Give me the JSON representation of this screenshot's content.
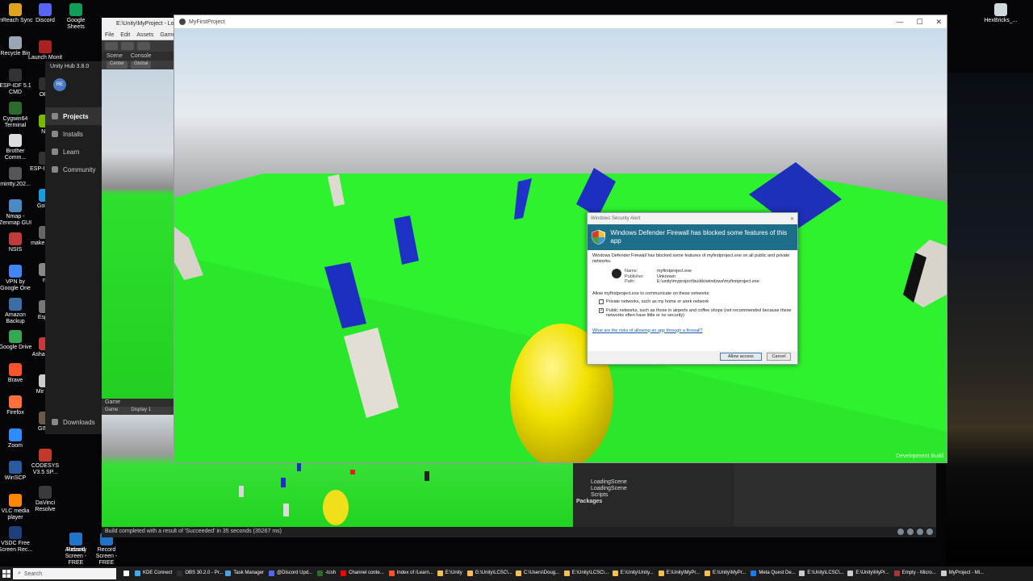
{
  "desktop": {
    "left_icons": [
      {
        "label": "inReach Sync",
        "color": "#e0a21c"
      },
      {
        "label": "Recycle Bin",
        "color": "#9aa5b5"
      },
      {
        "label": "ESP-IDF 5.1 CMD",
        "color": "#333333"
      },
      {
        "label": "Cygwin64 Terminal",
        "color": "#2b6b2b"
      },
      {
        "label": "Brother Comm...",
        "color": "#dddddd"
      },
      {
        "label": "mintty.202...",
        "color": "#555555"
      },
      {
        "label": "Nmap - Zenmap GUI",
        "color": "#4a8ac4"
      },
      {
        "label": "NSIS",
        "color": "#c23b3b"
      },
      {
        "label": "VPN by Google One",
        "color": "#4285f4"
      },
      {
        "label": "Amazon Backup",
        "color": "#3a6ea5"
      },
      {
        "label": "Google Drive",
        "color": "#34a853"
      },
      {
        "label": "Brave",
        "color": "#fb542b"
      },
      {
        "label": "Firefox",
        "color": "#ff7139"
      },
      {
        "label": "Zoom",
        "color": "#2d8cff"
      },
      {
        "label": "WinSCP",
        "color": "#2c5aa0"
      },
      {
        "label": "VLC media player",
        "color": "#ff8800"
      },
      {
        "label": "VSDC Free Screen Rec...",
        "color": "#1f3f7a"
      }
    ],
    "second_col_icons": [
      {
        "label": "Discord",
        "color": "#5865f2"
      },
      {
        "label": "Launch Monit",
        "color": "#aa2222"
      },
      {
        "label": "OBS",
        "color": "#302e31"
      },
      {
        "label": "NV",
        "color": "#76b900"
      },
      {
        "label": "ESP-I Powe",
        "color": "#333333"
      },
      {
        "label": "GoPro",
        "color": "#1b9ce0"
      },
      {
        "label": "make - Sho",
        "color": "#666666"
      },
      {
        "label": "nr",
        "color": "#888888"
      },
      {
        "label": "Espre",
        "color": "#777777"
      },
      {
        "label": "Asha Burn",
        "color": "#c43a3a"
      },
      {
        "label": "Mir Insi",
        "color": "#cccccc"
      },
      {
        "label": "GIMP",
        "color": "#6a5a4a"
      },
      {
        "label": "CODESYS V3.5 SP...",
        "color": "#c0392b"
      },
      {
        "label": "DaVinci Resolve",
        "color": "#3a3a3a"
      }
    ],
    "third_col_icons": [
      {
        "label": "Google Sheets",
        "color": "#0f9d58"
      },
      {
        "label": "Audacity",
        "color": "#f2b620"
      },
      {
        "label": "Record Screen - FREE",
        "color": "#2274c9"
      }
    ],
    "right_icon": {
      "label": "HexBricks_...",
      "color": "#cfd8dc"
    }
  },
  "unity_hub": {
    "title": "Unity Hub 3.8.0",
    "avatar": "RE",
    "nav": [
      {
        "label": "Projects",
        "icon": "cube-icon"
      },
      {
        "label": "Installs",
        "icon": "lock-icon"
      },
      {
        "label": "Learn",
        "icon": "graduation-cap-icon"
      },
      {
        "label": "Community",
        "icon": "people-icon"
      }
    ],
    "downloads": "Downloads"
  },
  "unity_editor": {
    "title": "E:\\Unity\\MyProject - Loadin",
    "menu": [
      "File",
      "Edit",
      "Assets",
      "GameObjec"
    ],
    "scene_tabs": [
      "Scene",
      "Console"
    ],
    "scene_bar": [
      "Center",
      "Global"
    ],
    "game_tab": "Game",
    "game_bar": [
      "Game",
      "Display 1"
    ],
    "hierarchy": [
      {
        "label": "LoadingScene",
        "bold": false
      },
      {
        "label": "LoadingScene",
        "bold": false
      },
      {
        "label": "Scripts",
        "bold": false
      },
      {
        "label": "Packages",
        "bold": true
      }
    ],
    "status": "Build completed with a result of 'Succeeded' in 35 seconds (35267 ms)"
  },
  "game_window": {
    "title": "MyFirstProject",
    "controls": [
      "—",
      "☐",
      "✕"
    ],
    "watermark": "Development Build"
  },
  "firewall_dialog": {
    "window_title": "Windows Security Alert",
    "heading": "Windows Defender Firewall has blocked some features of this app",
    "intro": "Windows Defender Firewall has blocked some features of myfirstproject.exe on all public and private networks.",
    "details": [
      {
        "label": "Name:",
        "value": "myfirstproject.exe"
      },
      {
        "label": "Publisher:",
        "value": "Unknown"
      },
      {
        "label": "Path:",
        "value": "E:\\unity\\myproject\\builds\\windows\\myfirstproject.exe"
      }
    ],
    "allow_prompt": "Allow myfirstproject.exe to communicate on these networks:",
    "private_option": {
      "label": "Private networks, such as my home or work network",
      "checked": false
    },
    "public_option": {
      "label": "Public networks, such as those in airports and coffee shops (not recommended because these networks often have little or no security)",
      "checked": true
    },
    "link": "What are the risks of allowing an app through a firewall?",
    "allow_button": "Allow access",
    "cancel_button": "Cancel"
  },
  "taskbar": {
    "search_placeholder": "Search",
    "apps": [
      {
        "label": "",
        "color": "#ffffff"
      },
      {
        "label": "KDE Connect",
        "color": "#3daee9"
      },
      {
        "label": "OBS 30.2.0 - Pr...",
        "color": "#302e31"
      },
      {
        "label": "Task Manager",
        "color": "#4aa3df"
      },
      {
        "label": "@Discord Upd...",
        "color": "#5865f2"
      },
      {
        "label": "-tcsh",
        "color": "#2b6b2b"
      },
      {
        "label": "Channel conte...",
        "color": "#ff0000"
      },
      {
        "label": "Index of /Learn...",
        "color": "#fb542b"
      },
      {
        "label": "E:\\Unity",
        "color": "#f2c14e"
      },
      {
        "label": "G:\\Unity\\LCSC\\...",
        "color": "#f2c14e"
      },
      {
        "label": "C:\\Users\\Doug...",
        "color": "#f2c14e"
      },
      {
        "label": "E:\\Unity\\LCSC\\...",
        "color": "#f2c14e"
      },
      {
        "label": "E:\\Unity\\Unity...",
        "color": "#f2c14e"
      },
      {
        "label": "E:\\Unity\\MyPr...",
        "color": "#f2c14e"
      },
      {
        "label": "E:\\Unity\\MyPr...",
        "color": "#f2c14e"
      },
      {
        "label": "Meta Quest De...",
        "color": "#1c7bf2"
      },
      {
        "label": "E:\\Unity\\LCSC\\...",
        "color": "#cccccc"
      },
      {
        "label": "E:\\Unity\\MyPr...",
        "color": "#cccccc"
      },
      {
        "label": "Empty - Micro...",
        "color": "#a4373a"
      },
      {
        "label": "MyProject - Mi...",
        "color": "#cccccc"
      }
    ]
  }
}
